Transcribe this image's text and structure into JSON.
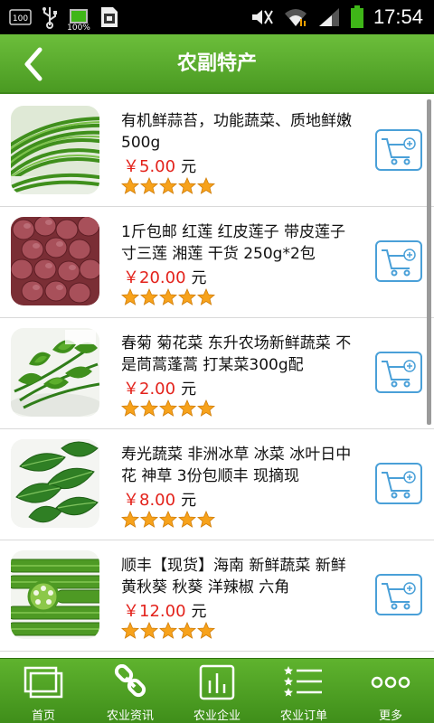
{
  "status_bar": {
    "left_icons": [
      "battery-100-badge-icon",
      "usb-icon",
      "battery-charging-icon",
      "sim-icon"
    ],
    "battery_small_label": "100%",
    "badge_label": "100",
    "time": "17:54"
  },
  "header": {
    "title": "农副特产",
    "back_icon": "chevron-left-icon"
  },
  "products": [
    {
      "name": "有机鲜蒜苔，功能蔬菜、质地鲜嫩 500g",
      "price": "￥5.00",
      "unit": "元",
      "rating": 5,
      "image": "garlic-scapes"
    },
    {
      "name": "1斤包邮 红莲 红皮莲子 带皮莲子 寸三莲 湘莲 干货 250g*2包",
      "price": "￥20.00",
      "unit": "元",
      "rating": 5,
      "image": "red-lotus-seeds"
    },
    {
      "name": "春菊 菊花菜 东升农场新鲜蔬菜 不是茼蒿蓬蒿 打某菜300g配",
      "price": "￥2.00",
      "unit": "元",
      "rating": 5,
      "image": "chrysanthemum-greens"
    },
    {
      "name": "寿光蔬菜 非洲冰草 冰菜 冰叶日中花 神草 3份包顺丰 现摘现",
      "price": "￥8.00",
      "unit": "元",
      "rating": 5,
      "image": "ice-plant-leaves"
    },
    {
      "name": "顺丰【现货】海南 新鲜蔬菜 新鲜黄秋葵 秋葵 洋辣椒 六角",
      "price": "￥12.00",
      "unit": "元",
      "rating": 5,
      "image": "okra"
    }
  ],
  "bottom_nav": [
    {
      "label": "首页",
      "icon": "home-windows-icon"
    },
    {
      "label": "农业资讯",
      "icon": "chain-link-icon"
    },
    {
      "label": "农业企业",
      "icon": "bar-chart-icon"
    },
    {
      "label": "农业订单",
      "icon": "star-list-icon"
    },
    {
      "label": "更多",
      "icon": "more-dots-icon"
    }
  ],
  "colors": {
    "header_green": "#5aad2e",
    "price_red": "#e3221b",
    "cart_blue": "#4aa0d8",
    "star_orange": "#f7a21b"
  }
}
